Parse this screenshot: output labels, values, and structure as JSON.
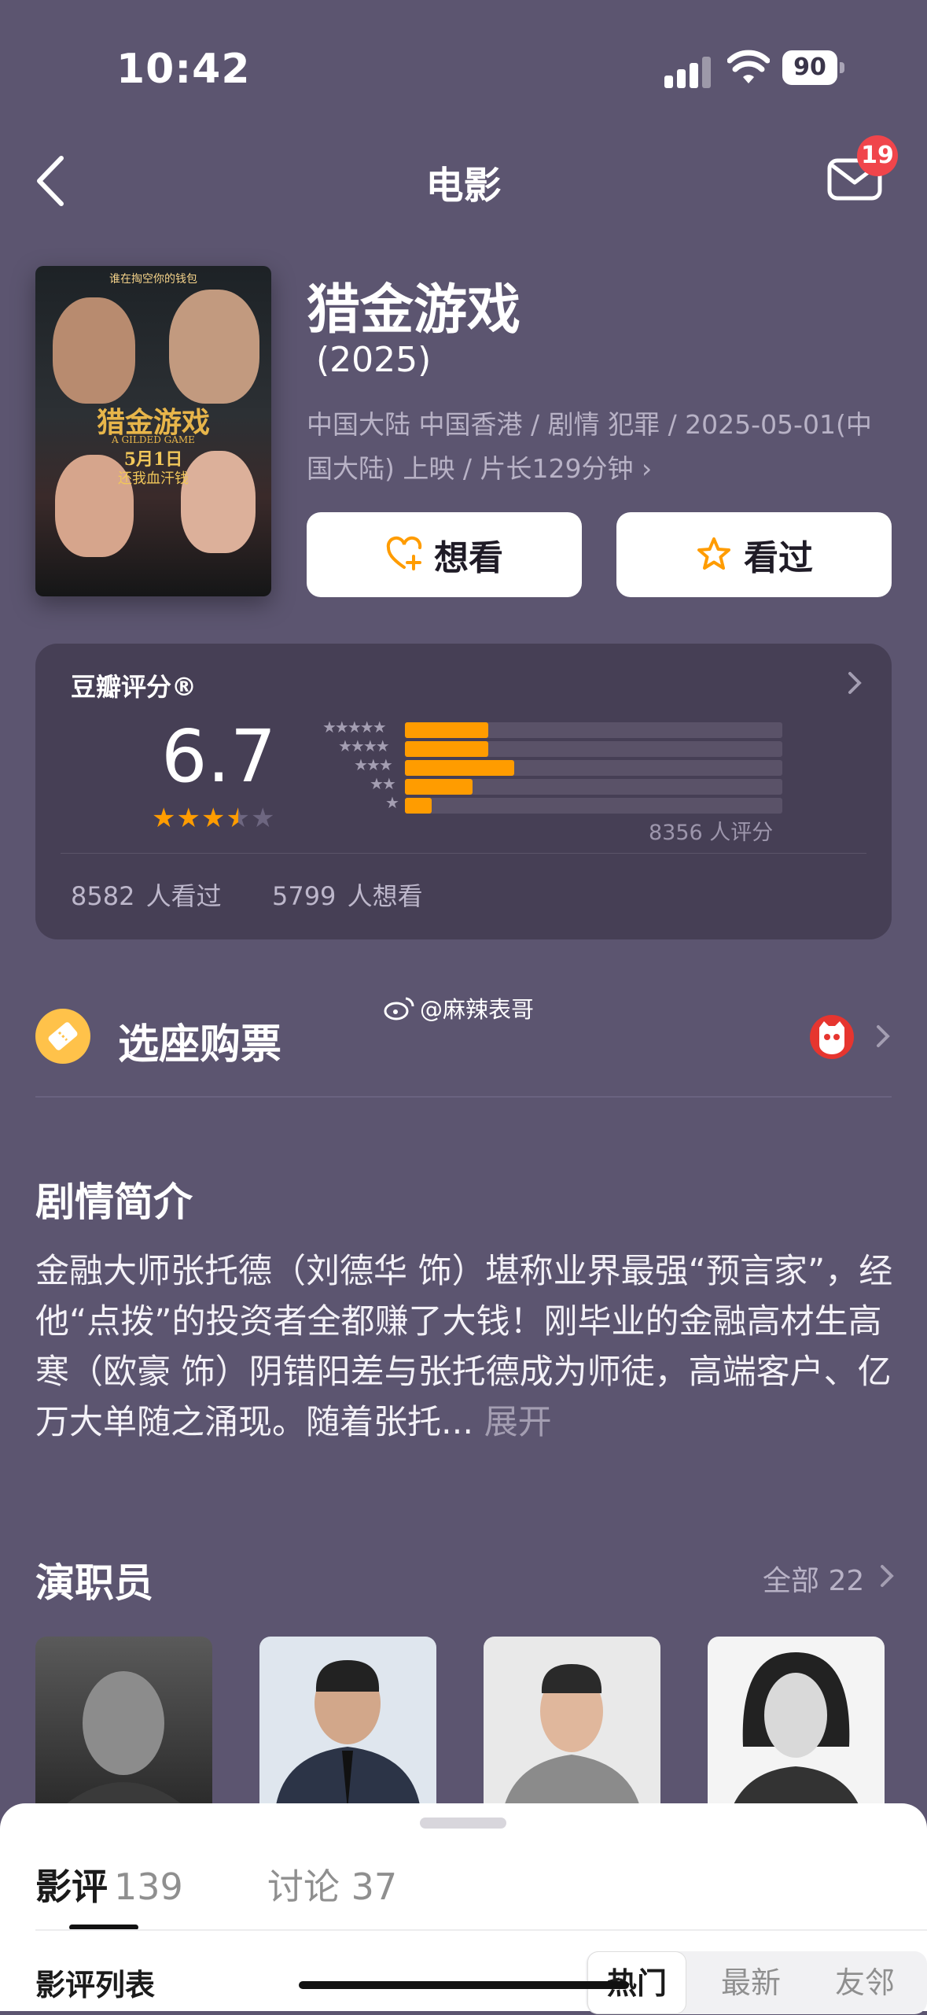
{
  "status_bar": {
    "time": "10:42",
    "battery": "90"
  },
  "nav": {
    "title": "电影",
    "badge": "19"
  },
  "poster": {
    "tagline": "谁在掏空你的钱包",
    "title_cn": "猎金游戏",
    "title_en": "A GILDED GAME",
    "date": "5月1日",
    "slogan": "还我血汗钱"
  },
  "movie": {
    "title": "猎金游戏",
    "year": "(2025)",
    "meta": "中国大陆 中国香港 / 剧情 犯罪 / 2025-05-01(中国大陆) 上映 / 片长129分钟 ›"
  },
  "actions": {
    "want": "想看",
    "seen": "看过"
  },
  "rating": {
    "label": "豆瓣评分®",
    "score": "6.7",
    "stars": 3.5,
    "distribution": [
      {
        "stars": 5,
        "fraction": 0.22
      },
      {
        "stars": 4,
        "fraction": 0.22
      },
      {
        "stars": 3,
        "fraction": 0.29
      },
      {
        "stars": 2,
        "fraction": 0.18
      },
      {
        "stars": 1,
        "fraction": 0.07
      }
    ],
    "count": "8356 人评分",
    "watched": "8582 人看过",
    "wish": "5799 人想看"
  },
  "ticket": {
    "label": "选座购票",
    "watermark": "@麻辣表哥"
  },
  "synopsis": {
    "title": "剧情简介",
    "text": "金融大师张托德（刘德华 饰）堪称业界最强“预言家”，经他“点拨”的投资者全都赚了大钱！刚毕业的金融高材生高寒（欧豪 饰）阴错阳差与张托德成为师徒，高端客户、亿万大单随之涌现。随着张托...",
    "expand": "展开"
  },
  "cast": {
    "title": "演职员",
    "all": "全部 22"
  },
  "sheet": {
    "tab_review": "影评",
    "review_count": "139",
    "tab_discuss": "讨论 37",
    "list_label": "影评列表",
    "sort_hot": "热门",
    "sort_new": "最新",
    "sort_friend": "友邻"
  },
  "colors": {
    "background": "#5c5570",
    "card": "#463f55",
    "accent": "#ff9c00",
    "badge": "#f0454b"
  }
}
